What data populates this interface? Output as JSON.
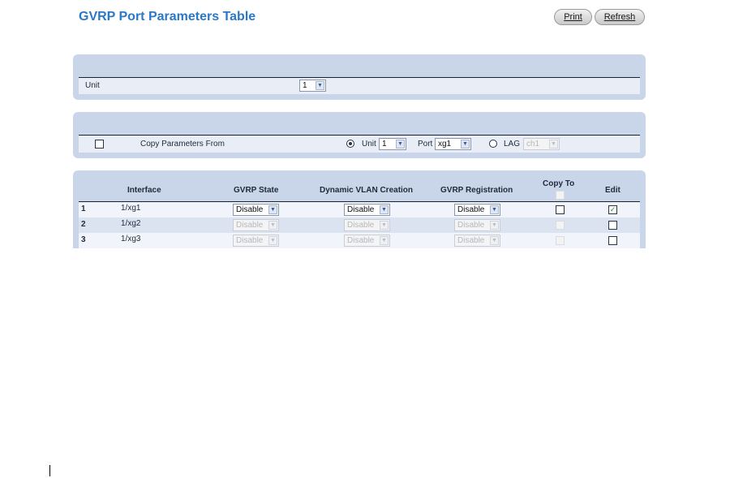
{
  "page": {
    "title": "GVRP Port Parameters Table",
    "buttons": {
      "print": "Print",
      "refresh": "Refresh"
    }
  },
  "unit_panel": {
    "label": "Unit",
    "unit_value": "1"
  },
  "copy_panel": {
    "copy_checked": false,
    "copy_label": "Copy Parameters From",
    "unit_radio_selected": true,
    "unit_label": "Unit",
    "unit_value": "1",
    "port_label": "Port",
    "port_value": "xg1",
    "lag_radio_selected": false,
    "lag_label": "LAG",
    "lag_value": "ch1"
  },
  "table": {
    "headers": {
      "interface": "Interface",
      "gvrp_state": "GVRP State",
      "dynamic_vlan": "Dynamic VLAN Creation",
      "gvrp_registration": "GVRP Registration",
      "copy_to": "Copy To",
      "edit": "Edit"
    },
    "rows": [
      {
        "index": "1",
        "interface": "1/xg1",
        "gvrp_state": "Disable",
        "dynamic_vlan": "Disable",
        "gvrp_registration": "Disable",
        "copy_to": false,
        "edit": true,
        "enabled": true
      },
      {
        "index": "2",
        "interface": "1/xg2",
        "gvrp_state": "Disable",
        "dynamic_vlan": "Disable",
        "gvrp_registration": "Disable",
        "copy_to": false,
        "edit": false,
        "enabled": false
      },
      {
        "index": "3",
        "interface": "1/xg3",
        "gvrp_state": "Disable",
        "dynamic_vlan": "Disable",
        "gvrp_registration": "Disable",
        "copy_to": false,
        "edit": false,
        "enabled": false
      }
    ]
  },
  "icons": {
    "dropdown": "chevron-down-icon",
    "check": "check-icon"
  },
  "colors": {
    "title": "#2a78c8",
    "panel": "#c9d6ea",
    "row_odd": "#f1f4fb",
    "row_even": "#dbe3f1"
  }
}
